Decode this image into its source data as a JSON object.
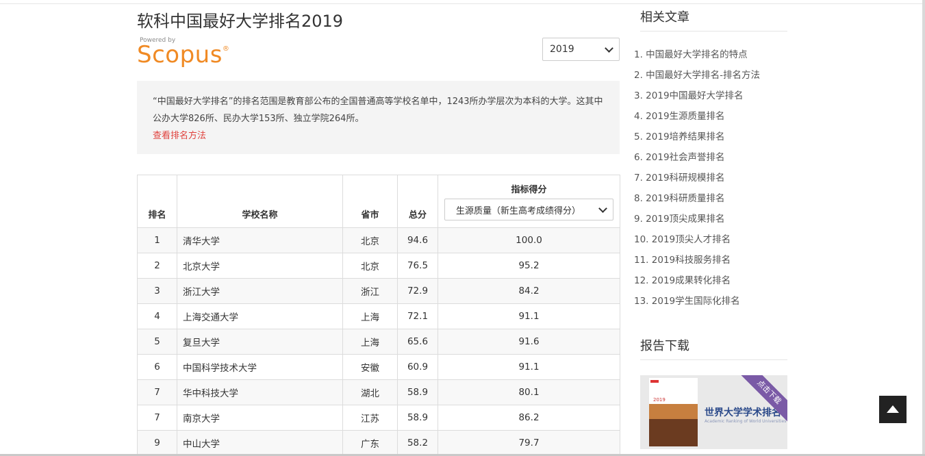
{
  "page": {
    "title": "软科中国最好大学排名2019"
  },
  "scopus": {
    "powered_by": "Powered by",
    "logo_text": "Scopus",
    "logo_mark": "®"
  },
  "year_select": {
    "value": "2019"
  },
  "intro": {
    "text": "“中国最好大学排名”的排名范围是教育部公布的全国普通高等学校名单中，1243所办学层次为本科的大学。这其中公办大学826所、民办大学153所、独立学院264所。",
    "method_link": "查看排名方法"
  },
  "table": {
    "headers": {
      "rank": "排名",
      "name": "学校名称",
      "province": "省市",
      "total": "总分",
      "metric": "指标得分",
      "metric_select": "生源质量（新生高考成绩得分）"
    },
    "rows": [
      {
        "rank": "1",
        "name": "清华大学",
        "province": "北京",
        "total": "94.6",
        "metric": "100.0"
      },
      {
        "rank": "2",
        "name": "北京大学",
        "province": "北京",
        "total": "76.5",
        "metric": "95.2"
      },
      {
        "rank": "3",
        "name": "浙江大学",
        "province": "浙江",
        "total": "72.9",
        "metric": "84.2"
      },
      {
        "rank": "4",
        "name": "上海交通大学",
        "province": "上海",
        "total": "72.1",
        "metric": "91.1"
      },
      {
        "rank": "5",
        "name": "复旦大学",
        "province": "上海",
        "total": "65.6",
        "metric": "91.6"
      },
      {
        "rank": "6",
        "name": "中国科学技术大学",
        "province": "安徽",
        "total": "60.9",
        "metric": "91.1"
      },
      {
        "rank": "7",
        "name": "华中科技大学",
        "province": "湖北",
        "total": "58.9",
        "metric": "80.1"
      },
      {
        "rank": "7",
        "name": "南京大学",
        "province": "江苏",
        "total": "58.9",
        "metric": "86.2"
      },
      {
        "rank": "9",
        "name": "中山大学",
        "province": "广东",
        "total": "58.2",
        "metric": "79.7"
      }
    ]
  },
  "sidebar": {
    "related_title": "相关文章",
    "articles": [
      "1. 中国最好大学排名的特点",
      "2. 中国最好大学排名-排名方法",
      "3. 2019中国最好大学排名",
      "4. 2019生源质量排名",
      "5. 2019培养结果排名",
      "6. 2019社会声誉排名",
      "7. 2019科研规模排名",
      "8. 2019科研质量排名",
      "9. 2019顶尖成果排名",
      "10. 2019顶尖人才排名",
      "11. 2019科技服务排名",
      "12. 2019成果转化排名",
      "13. 2019学生国际化排名"
    ],
    "download_title": "报告下载",
    "banner": {
      "ribbon": "点击下载",
      "title": "世界大学学术排名",
      "subtitle": "Academic Ranking of World Universities",
      "book_year": "2019"
    }
  },
  "colors": {
    "accent_link": "#e0413c",
    "scopus_orange": "#f08a24",
    "ribbon_purple": "#7a5aa6"
  },
  "icons": {
    "year_select_arrow": "chevron-down-icon",
    "back_to_top": "arrow-up-icon"
  }
}
